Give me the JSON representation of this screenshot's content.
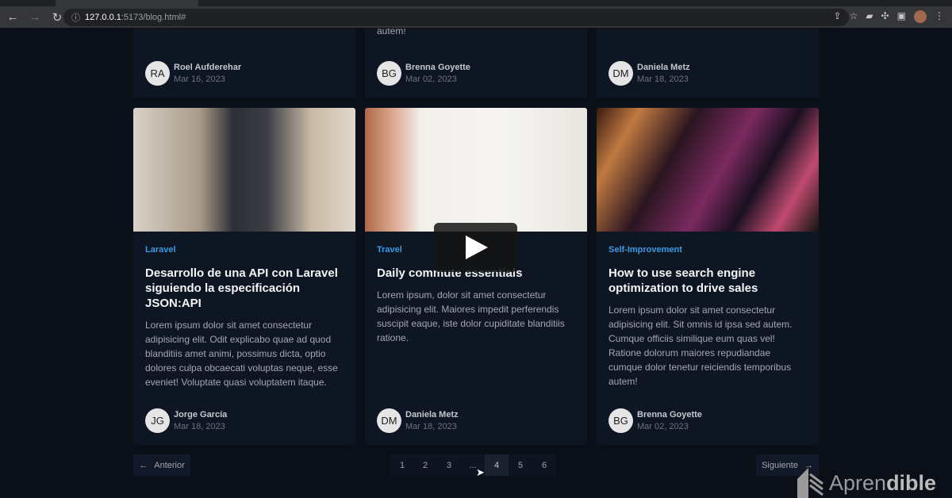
{
  "browser": {
    "url_host": "127.0.0.1",
    "url_path": ":5173/blog.html#"
  },
  "top_row": [
    {
      "excerpt_tail": "",
      "author": "Roel Aufderehar",
      "initials": "RA",
      "date": "Mar 16, 2023"
    },
    {
      "excerpt_tail": "autem!",
      "author": "Brenna Goyette",
      "initials": "BG",
      "date": "Mar 02, 2023"
    },
    {
      "excerpt_tail": "",
      "author": "Daniela Metz",
      "initials": "DM",
      "date": "Mar 18, 2023"
    }
  ],
  "posts": [
    {
      "category": "Laravel",
      "title": "Desarrollo de una API con Laravel siguiendo la especificación JSON:API",
      "excerpt": "Lorem ipsum dolor sit amet consectetur adipisicing elit. Odit explicabo quae ad quod blanditiis amet animi, possimus dicta, optio dolores culpa obcaecati voluptas neque, esse eveniet! Voluptate quasi voluptatem itaque.",
      "author": "Jorge García",
      "initials": "JG",
      "date": "Mar 18, 2023"
    },
    {
      "category": "Travel",
      "title": "Daily commute essentials",
      "excerpt": "Lorem ipsum, dolor sit amet consectetur adipisicing elit. Maiores impedit perferendis suscipit eaque, iste dolor cupiditate blanditiis ratione.",
      "author": "Daniela Metz",
      "initials": "DM",
      "date": "Mar 18, 2023"
    },
    {
      "category": "Self-Improvement",
      "title": "How to use search engine optimization to drive sales",
      "excerpt": "Lorem ipsum dolor sit amet consectetur adipisicing elit. Sit omnis id ipsa sed autem. Cumque officiis similique eum quas vel! Ratione dolorum maiores repudiandae cumque dolor tenetur reiciendis temporibus autem!",
      "author": "Brenna Goyette",
      "initials": "BG",
      "date": "Mar 02, 2023"
    }
  ],
  "pagination": {
    "prev": "Anterior",
    "next": "Siguiente",
    "pages": [
      "1",
      "2",
      "3",
      "...",
      "4",
      "5",
      "6"
    ],
    "current": "4"
  },
  "watermark": {
    "brand_a": "Apren",
    "brand_b": "dible"
  }
}
